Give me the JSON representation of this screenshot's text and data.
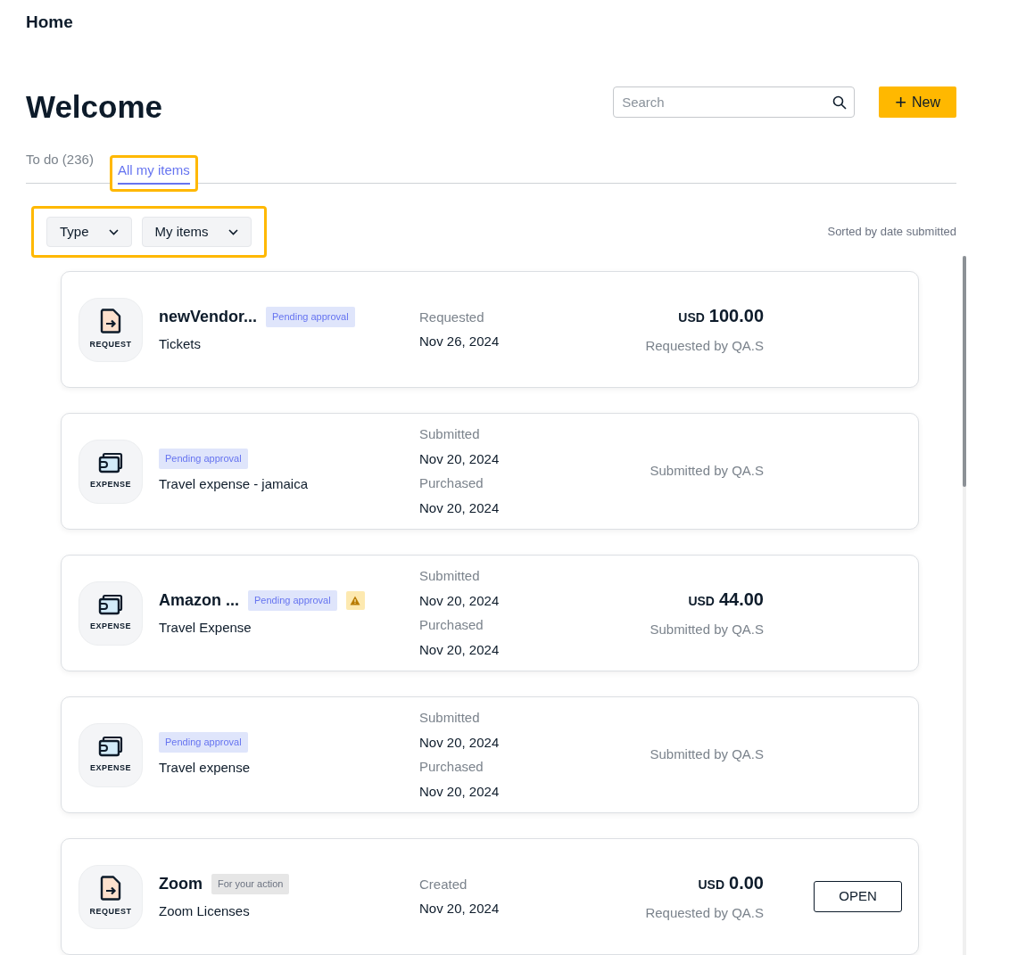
{
  "header": {
    "title": "Home"
  },
  "page": {
    "heading": "Welcome",
    "search": {
      "placeholder": "Search"
    },
    "new_button": {
      "icon": "+",
      "label": "New"
    }
  },
  "tabs": [
    {
      "label": "To do (236)",
      "selected": false,
      "highlighted": false
    },
    {
      "label": "All my items",
      "selected": true,
      "highlighted": true
    }
  ],
  "filters": {
    "highlighted": true,
    "items": [
      {
        "label": "Type"
      },
      {
        "label": "My items"
      }
    ]
  },
  "sort_label": "Sorted by date submitted",
  "items": [
    {
      "kind": "request",
      "icon_label": "REQUEST",
      "title": "newVendor...",
      "badge": {
        "text": "Pending approval",
        "kind": "pending"
      },
      "warning": false,
      "subtitle": "Tickets",
      "dates": [
        {
          "label": "Requested",
          "value": "Nov 26, 2024"
        }
      ],
      "amount": {
        "currency": "USD",
        "value": "100.00"
      },
      "by": "Requested by QA.S"
    },
    {
      "kind": "expense",
      "icon_label": "EXPENSE",
      "badge": {
        "text": "Pending approval",
        "kind": "pending"
      },
      "warning": false,
      "subtitle": "Travel expense - jamaica",
      "dates": [
        {
          "label": "Submitted",
          "value": "Nov 20, 2024"
        },
        {
          "label": "Purchased",
          "value": "Nov 20, 2024"
        }
      ],
      "by": "Submitted by QA.S"
    },
    {
      "kind": "expense",
      "icon_label": "EXPENSE",
      "title": "Amazon ...",
      "badge": {
        "text": "Pending approval",
        "kind": "pending"
      },
      "warning": true,
      "subtitle": "Travel Expense",
      "dates": [
        {
          "label": "Submitted",
          "value": "Nov 20, 2024"
        },
        {
          "label": "Purchased",
          "value": "Nov 20, 2024"
        }
      ],
      "amount": {
        "currency": "USD",
        "value": "44.00"
      },
      "by": "Submitted by QA.S"
    },
    {
      "kind": "expense",
      "icon_label": "EXPENSE",
      "badge": {
        "text": "Pending approval",
        "kind": "pending"
      },
      "warning": false,
      "subtitle": "Travel expense",
      "dates": [
        {
          "label": "Submitted",
          "value": "Nov 20, 2024"
        },
        {
          "label": "Purchased",
          "value": "Nov 20, 2024"
        }
      ],
      "by": "Submitted by QA.S"
    },
    {
      "kind": "request",
      "icon_label": "REQUEST",
      "title": "Zoom",
      "badge": {
        "text": "For your action",
        "kind": "action"
      },
      "warning": false,
      "subtitle": "Zoom Licenses",
      "dates": [
        {
          "label": "Created",
          "value": "Nov 20, 2024"
        }
      ],
      "amount": {
        "currency": "USD",
        "value": "0.00"
      },
      "by": "Requested by QA.S",
      "action": "OPEN"
    }
  ]
}
